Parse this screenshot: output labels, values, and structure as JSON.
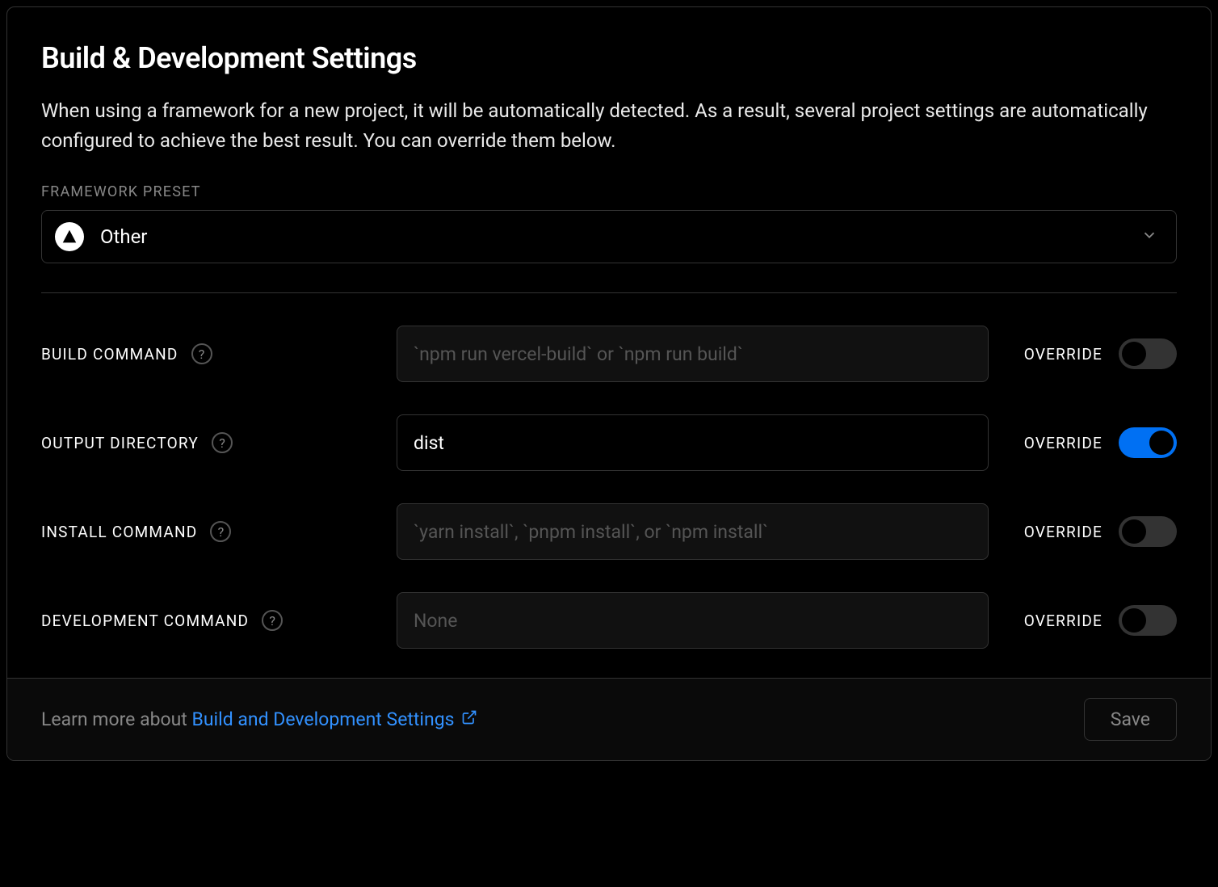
{
  "title": "Build & Development Settings",
  "description": "When using a framework for a new project, it will be automatically detected. As a result, several project settings are automatically configured to achieve the best result. You can override them below.",
  "framework_preset": {
    "label": "FRAMEWORK PRESET",
    "selected": "Other",
    "icon": "triangle-icon"
  },
  "override_label": "OVERRIDE",
  "rows": {
    "build_command": {
      "label": "BUILD COMMAND",
      "value": "",
      "placeholder": "`npm run vercel-build` or `npm run build`",
      "override": false
    },
    "output_directory": {
      "label": "OUTPUT DIRECTORY",
      "value": "dist",
      "placeholder": "",
      "override": true
    },
    "install_command": {
      "label": "INSTALL COMMAND",
      "value": "",
      "placeholder": "`yarn install`, `pnpm install`, or `npm install`",
      "override": false
    },
    "development_command": {
      "label": "DEVELOPMENT COMMAND",
      "value": "",
      "placeholder": "None",
      "override": false
    }
  },
  "footer": {
    "prefix": "Learn more about ",
    "link_text": "Build and Development Settings",
    "save_label": "Save"
  },
  "colors": {
    "accent": "#0070f3",
    "link": "#3291ff",
    "border": "#333333",
    "muted": "#888888"
  }
}
